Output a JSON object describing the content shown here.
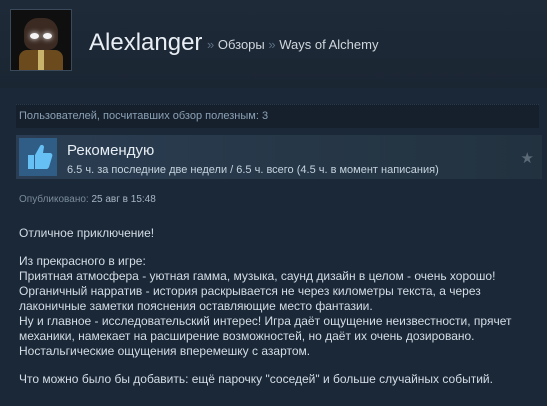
{
  "header": {
    "username": "Alexlanger",
    "sep1": "»",
    "reviews_link": "Обзоры",
    "sep2": "»",
    "game_link": "Ways of Alchemy"
  },
  "helpful": "Пользователей, посчитавших обзор полезным: 3",
  "recommendation": {
    "title": "Рекомендую",
    "hours": "6.5 ч. за последние две недели / 6.5 ч. всего (4.5 ч. в момент написания)",
    "icon": "thumbs-up-icon",
    "award_icon": "star-icon"
  },
  "posted": {
    "label": "Опубликовано:",
    "date": "25 авг в 15:48"
  },
  "review": {
    "line1": "Отличное приключение!",
    "line2": "Из прекрасного в игре:",
    "line3": "Приятная атмосфера - уютная гамма, музыка, саунд дизайн в целом - очень хорошо!",
    "line4": "Органичный нарратив - история раскрывается не через километры текста, а через лаконичные заметки пояснения оставляющие место фантазии.",
    "line5": "Ну и главное - исследовательский интерес! Игра даёт ощущение неизвестности, прячет механики, намекает на расширение возможностей, но даёт их очень дозировано.",
    "line6": "Ностальгические ощущения вперемешку с азартом.",
    "line7": "Что можно было бы добавить: ещё парочку \"соседей\" и больше случайных событий."
  },
  "colors": {
    "background": "#1b2838",
    "recommend_tile": "#2f5d86",
    "thumb": "#66c0f4"
  }
}
